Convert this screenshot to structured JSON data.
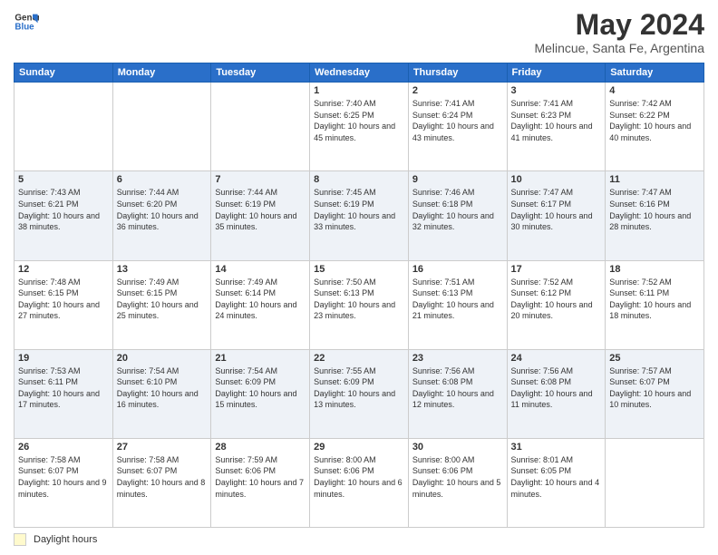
{
  "header": {
    "logo_line1": "General",
    "logo_line2": "Blue",
    "main_title": "May 2024",
    "subtitle": "Melincue, Santa Fe, Argentina"
  },
  "footer": {
    "daylight_label": "Daylight hours"
  },
  "weekdays": [
    "Sunday",
    "Monday",
    "Tuesday",
    "Wednesday",
    "Thursday",
    "Friday",
    "Saturday"
  ],
  "weeks": [
    [
      {
        "day": "",
        "info": ""
      },
      {
        "day": "",
        "info": ""
      },
      {
        "day": "",
        "info": ""
      },
      {
        "day": "1",
        "info": "Sunrise: 7:40 AM\nSunset: 6:25 PM\nDaylight: 10 hours\nand 45 minutes."
      },
      {
        "day": "2",
        "info": "Sunrise: 7:41 AM\nSunset: 6:24 PM\nDaylight: 10 hours\nand 43 minutes."
      },
      {
        "day": "3",
        "info": "Sunrise: 7:41 AM\nSunset: 6:23 PM\nDaylight: 10 hours\nand 41 minutes."
      },
      {
        "day": "4",
        "info": "Sunrise: 7:42 AM\nSunset: 6:22 PM\nDaylight: 10 hours\nand 40 minutes."
      }
    ],
    [
      {
        "day": "5",
        "info": "Sunrise: 7:43 AM\nSunset: 6:21 PM\nDaylight: 10 hours\nand 38 minutes."
      },
      {
        "day": "6",
        "info": "Sunrise: 7:44 AM\nSunset: 6:20 PM\nDaylight: 10 hours\nand 36 minutes."
      },
      {
        "day": "7",
        "info": "Sunrise: 7:44 AM\nSunset: 6:19 PM\nDaylight: 10 hours\nand 35 minutes."
      },
      {
        "day": "8",
        "info": "Sunrise: 7:45 AM\nSunset: 6:19 PM\nDaylight: 10 hours\nand 33 minutes."
      },
      {
        "day": "9",
        "info": "Sunrise: 7:46 AM\nSunset: 6:18 PM\nDaylight: 10 hours\nand 32 minutes."
      },
      {
        "day": "10",
        "info": "Sunrise: 7:47 AM\nSunset: 6:17 PM\nDaylight: 10 hours\nand 30 minutes."
      },
      {
        "day": "11",
        "info": "Sunrise: 7:47 AM\nSunset: 6:16 PM\nDaylight: 10 hours\nand 28 minutes."
      }
    ],
    [
      {
        "day": "12",
        "info": "Sunrise: 7:48 AM\nSunset: 6:15 PM\nDaylight: 10 hours\nand 27 minutes."
      },
      {
        "day": "13",
        "info": "Sunrise: 7:49 AM\nSunset: 6:15 PM\nDaylight: 10 hours\nand 25 minutes."
      },
      {
        "day": "14",
        "info": "Sunrise: 7:49 AM\nSunset: 6:14 PM\nDaylight: 10 hours\nand 24 minutes."
      },
      {
        "day": "15",
        "info": "Sunrise: 7:50 AM\nSunset: 6:13 PM\nDaylight: 10 hours\nand 23 minutes."
      },
      {
        "day": "16",
        "info": "Sunrise: 7:51 AM\nSunset: 6:13 PM\nDaylight: 10 hours\nand 21 minutes."
      },
      {
        "day": "17",
        "info": "Sunrise: 7:52 AM\nSunset: 6:12 PM\nDaylight: 10 hours\nand 20 minutes."
      },
      {
        "day": "18",
        "info": "Sunrise: 7:52 AM\nSunset: 6:11 PM\nDaylight: 10 hours\nand 18 minutes."
      }
    ],
    [
      {
        "day": "19",
        "info": "Sunrise: 7:53 AM\nSunset: 6:11 PM\nDaylight: 10 hours\nand 17 minutes."
      },
      {
        "day": "20",
        "info": "Sunrise: 7:54 AM\nSunset: 6:10 PM\nDaylight: 10 hours\nand 16 minutes."
      },
      {
        "day": "21",
        "info": "Sunrise: 7:54 AM\nSunset: 6:09 PM\nDaylight: 10 hours\nand 15 minutes."
      },
      {
        "day": "22",
        "info": "Sunrise: 7:55 AM\nSunset: 6:09 PM\nDaylight: 10 hours\nand 13 minutes."
      },
      {
        "day": "23",
        "info": "Sunrise: 7:56 AM\nSunset: 6:08 PM\nDaylight: 10 hours\nand 12 minutes."
      },
      {
        "day": "24",
        "info": "Sunrise: 7:56 AM\nSunset: 6:08 PM\nDaylight: 10 hours\nand 11 minutes."
      },
      {
        "day": "25",
        "info": "Sunrise: 7:57 AM\nSunset: 6:07 PM\nDaylight: 10 hours\nand 10 minutes."
      }
    ],
    [
      {
        "day": "26",
        "info": "Sunrise: 7:58 AM\nSunset: 6:07 PM\nDaylight: 10 hours\nand 9 minutes."
      },
      {
        "day": "27",
        "info": "Sunrise: 7:58 AM\nSunset: 6:07 PM\nDaylight: 10 hours\nand 8 minutes."
      },
      {
        "day": "28",
        "info": "Sunrise: 7:59 AM\nSunset: 6:06 PM\nDaylight: 10 hours\nand 7 minutes."
      },
      {
        "day": "29",
        "info": "Sunrise: 8:00 AM\nSunset: 6:06 PM\nDaylight: 10 hours\nand 6 minutes."
      },
      {
        "day": "30",
        "info": "Sunrise: 8:00 AM\nSunset: 6:06 PM\nDaylight: 10 hours\nand 5 minutes."
      },
      {
        "day": "31",
        "info": "Sunrise: 8:01 AM\nSunset: 6:05 PM\nDaylight: 10 hours\nand 4 minutes."
      },
      {
        "day": "",
        "info": ""
      }
    ]
  ]
}
